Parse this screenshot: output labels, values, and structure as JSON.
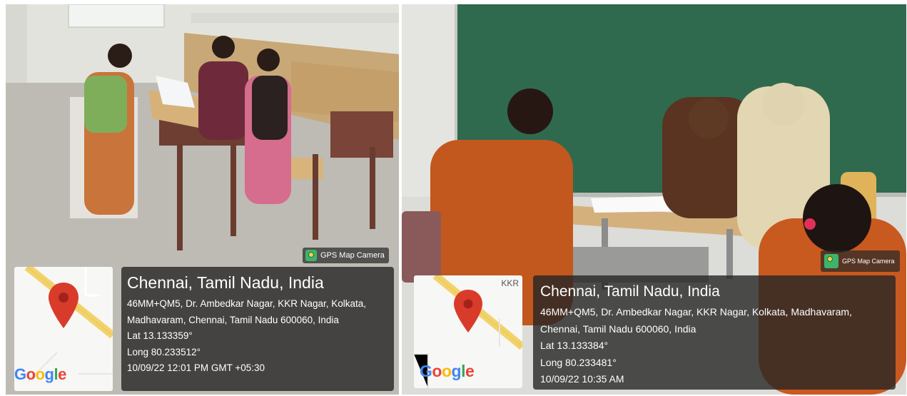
{
  "photos": [
    {
      "id": "left",
      "scene": "Three women seated at wooden classroom benches filling in paperwork in a bare classroom",
      "badge": "GPS Map Camera",
      "map": {
        "label": "",
        "logo": "Google"
      },
      "info": {
        "title": "Chennai, Tamil Nadu, India",
        "address1": "46MM+QM5, Dr. Ambedkar Nagar, KKR Nagar, Kolkata,",
        "address2": "Madhavaram, Chennai, Tamil Nadu 600060, India",
        "lat": "Lat 13.133359°",
        "long": "Long 80.233512°",
        "datetime": "10/09/22 12:01 PM GMT +05:30"
      }
    },
    {
      "id": "right",
      "scene": "Women seated around a small table in front of a green chalkboard filling in a form",
      "badge": "GPS Map Camera",
      "map": {
        "label": "KKR",
        "logo": "Google"
      },
      "info": {
        "title": "Chennai, Tamil Nadu, India",
        "address1": "46MM+QM5, Dr. Ambedkar Nagar, KKR Nagar, Kolkata, Madhavaram,",
        "address2": "Chennai, Tamil Nadu 600060, India",
        "lat": "Lat 13.133384°",
        "long": "Long 80.233481°",
        "datetime": "10/09/22 10:35 AM"
      }
    }
  ],
  "colors": {
    "google_blue": "#4285F4",
    "google_red": "#EA4335",
    "google_yellow": "#FBBC05",
    "google_green": "#34A853",
    "map_road": "#f2d36b",
    "map_pin": "#d93b2b",
    "overlay": "rgba(38,38,38,0.80)"
  }
}
